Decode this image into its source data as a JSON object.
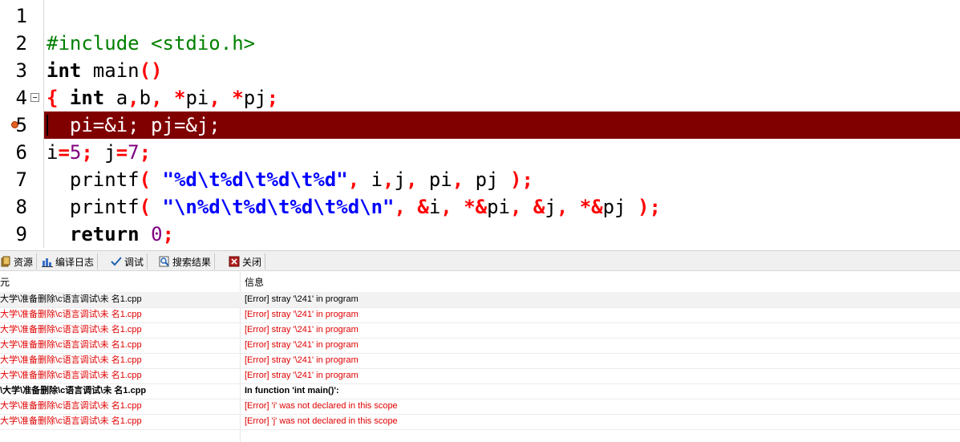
{
  "editor": {
    "lines": [
      {
        "num": "1"
      },
      {
        "num": "2",
        "parts": [
          [
            "pp",
            "#include <stdio.h>"
          ]
        ]
      },
      {
        "num": "3",
        "parts": [
          [
            "kw",
            "int"
          ],
          [
            "",
            " main"
          ],
          [
            "sym",
            "()"
          ]
        ]
      },
      {
        "num": "4",
        "parts": [
          [
            "sym",
            "{"
          ],
          [
            "",
            " "
          ],
          [
            "kw",
            "int"
          ],
          [
            "",
            " a"
          ],
          [
            "sym",
            ","
          ],
          [
            "",
            "b"
          ],
          [
            "sym",
            ","
          ],
          [
            "",
            " "
          ],
          [
            "sym",
            "*"
          ],
          [
            "",
            "pi"
          ],
          [
            "sym",
            ","
          ],
          [
            "",
            " "
          ],
          [
            "sym",
            "*"
          ],
          [
            "",
            "pj"
          ],
          [
            "sym",
            ";"
          ]
        ]
      },
      {
        "num": "5",
        "parts": [
          [
            "",
            "  pi=&i; pj=&j;"
          ]
        ],
        "active": true
      },
      {
        "num": "6",
        "parts": [
          [
            "",
            "i"
          ],
          [
            "sym",
            "="
          ],
          [
            "num",
            "5"
          ],
          [
            "sym",
            ";"
          ],
          [
            "",
            " j"
          ],
          [
            "sym",
            "="
          ],
          [
            "num",
            "7"
          ],
          [
            "sym",
            ";"
          ]
        ]
      },
      {
        "num": "7",
        "parts": [
          [
            "",
            "  printf"
          ],
          [
            "sym",
            "("
          ],
          [
            "",
            " "
          ],
          [
            "str",
            "\"%d\\t%d\\t%d\\t%d\""
          ],
          [
            "sym",
            ","
          ],
          [
            "",
            " i"
          ],
          [
            "sym",
            ","
          ],
          [
            "",
            "j"
          ],
          [
            "sym",
            ","
          ],
          [
            "",
            " pi"
          ],
          [
            "sym",
            ","
          ],
          [
            "",
            " pj "
          ],
          [
            "sym",
            ");"
          ]
        ]
      },
      {
        "num": "8",
        "parts": [
          [
            "",
            "  printf"
          ],
          [
            "sym",
            "("
          ],
          [
            "",
            " "
          ],
          [
            "str",
            "\"\\n%d\\t%d\\t%d\\t%d\\n\""
          ],
          [
            "sym",
            ","
          ],
          [
            "",
            " "
          ],
          [
            "sym",
            "&"
          ],
          [
            "",
            "i"
          ],
          [
            "sym",
            ","
          ],
          [
            "",
            " "
          ],
          [
            "sym",
            "*&"
          ],
          [
            "",
            "pi"
          ],
          [
            "sym",
            ","
          ],
          [
            "",
            " "
          ],
          [
            "sym",
            "&"
          ],
          [
            "",
            "j"
          ],
          [
            "sym",
            ","
          ],
          [
            "",
            " "
          ],
          [
            "sym",
            "*&"
          ],
          [
            "",
            "pj "
          ],
          [
            "sym",
            ");"
          ]
        ]
      },
      {
        "num": "9",
        "parts": [
          [
            "",
            "  "
          ],
          [
            "kw",
            "return"
          ],
          [
            "",
            " "
          ],
          [
            "num",
            "0"
          ],
          [
            "sym",
            ";"
          ]
        ]
      }
    ]
  },
  "tabs": [
    {
      "label": "资源",
      "icon": "resource-icon"
    },
    {
      "label": "编译日志",
      "icon": "chart-icon"
    },
    {
      "label": "调试",
      "icon": "check-icon"
    },
    {
      "label": "搜索结果",
      "icon": "search-icon"
    },
    {
      "label": "关闭",
      "icon": "close-icon"
    }
  ],
  "results": {
    "headers": {
      "unit": "元",
      "message": "信息"
    },
    "rows": [
      {
        "unit": "大学\\准备删除\\c语言调试\\未 名1.cpp",
        "message": "[Error] stray '\\241' in program",
        "style": "first"
      },
      {
        "unit": "大学\\准备删除\\c语言调试\\未 名1.cpp",
        "message": "[Error] stray '\\241' in program",
        "style": "err"
      },
      {
        "unit": "大学\\准备删除\\c语言调试\\未 名1.cpp",
        "message": "[Error] stray '\\241' in program",
        "style": "err"
      },
      {
        "unit": "大学\\准备删除\\c语言调试\\未 名1.cpp",
        "message": "[Error] stray '\\241' in program",
        "style": "err"
      },
      {
        "unit": "大学\\准备删除\\c语言调试\\未 名1.cpp",
        "message": "[Error] stray '\\241' in program",
        "style": "err"
      },
      {
        "unit": "大学\\准备删除\\c语言调试\\未 名1.cpp",
        "message": "[Error] stray '\\241' in program",
        "style": "err"
      },
      {
        "unit": "\\大学\\准备删除\\c语言调试\\未 名1.cpp",
        "message": "In function 'int main()':",
        "style": "bold"
      },
      {
        "unit": "大学\\准备删除\\c语言调试\\未 名1.cpp",
        "message": "[Error] 'i' was not declared in this scope",
        "style": "err"
      },
      {
        "unit": "大学\\准备删除\\c语言调试\\未 名1.cpp",
        "message": "[Error] 'j' was not declared in this scope",
        "style": "err"
      }
    ]
  },
  "colors": {
    "active_line": "#800000",
    "error_text": "#e00000",
    "string": "#0000ff",
    "symbol": "#ff0000",
    "preprocessor": "#008000"
  }
}
